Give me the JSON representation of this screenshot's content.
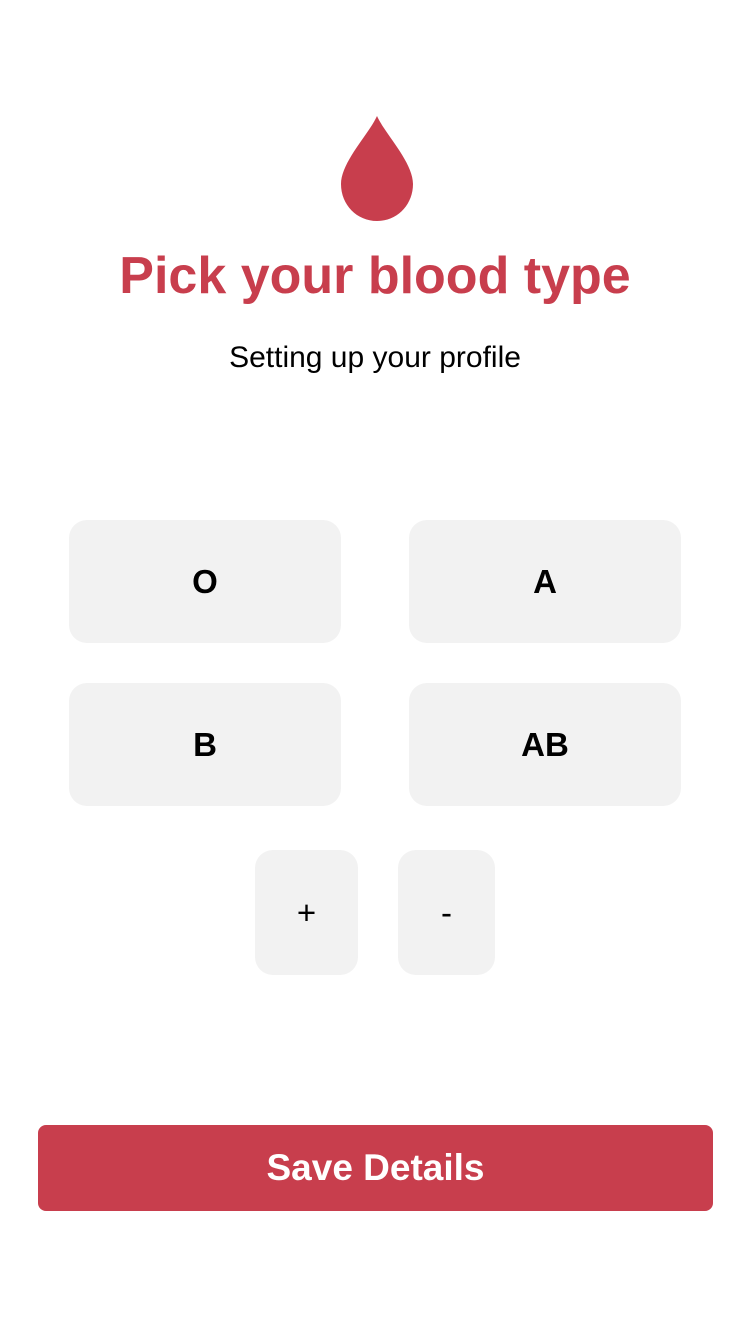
{
  "header": {
    "icon": "blood-drop-icon",
    "title": "Pick your blood type",
    "subtitle": "Setting up your profile"
  },
  "blood_types": {
    "o": "O",
    "a": "A",
    "b": "B",
    "ab": "AB"
  },
  "rh_factor": {
    "positive": "+",
    "negative": "-"
  },
  "footer": {
    "save_label": "Save Details"
  },
  "colors": {
    "accent": "#c83e4d",
    "button_bg": "#f2f2f2",
    "text": "#000000",
    "background": "#ffffff"
  }
}
